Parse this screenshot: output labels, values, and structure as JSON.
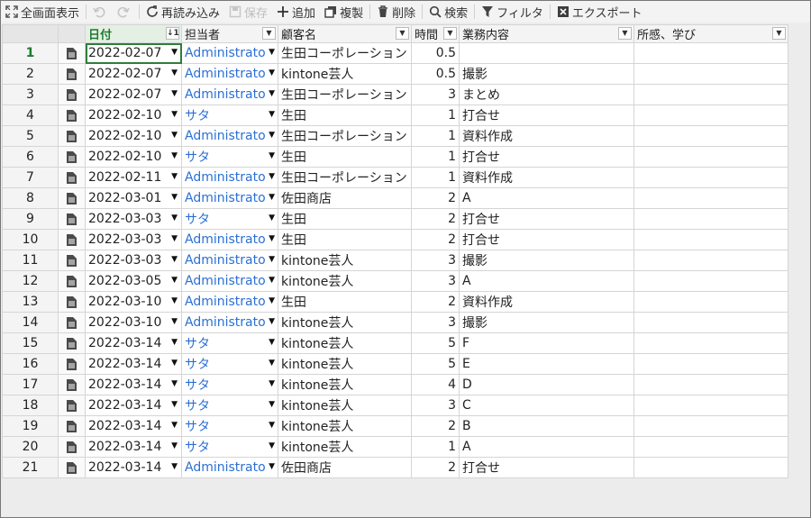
{
  "toolbar": {
    "fullscreen": "全画面表示",
    "reload": "再読み込み",
    "save": "保存",
    "add": "追加",
    "duplicate": "複製",
    "delete": "削除",
    "search": "検索",
    "filter": "フィルタ",
    "export": "エクスポート"
  },
  "columns": {
    "date": "日付",
    "owner": "担当者",
    "customer": "顧客名",
    "hours": "時間",
    "task": "業務内容",
    "notes": "所感、学び"
  },
  "rows": [
    {
      "n": "1",
      "date": "2022-02-07",
      "owner": "Administrato",
      "customer": "生田コーポレーション",
      "hours": "0.5",
      "task": "",
      "notes": ""
    },
    {
      "n": "2",
      "date": "2022-02-07",
      "owner": "Administrato",
      "customer": "kintone芸人",
      "hours": "0.5",
      "task": "撮影",
      "notes": ""
    },
    {
      "n": "3",
      "date": "2022-02-07",
      "owner": "Administrato",
      "customer": "生田コーポレーション",
      "hours": "3",
      "task": "まとめ",
      "notes": ""
    },
    {
      "n": "4",
      "date": "2022-02-10",
      "owner": "サタ",
      "customer": "生田",
      "hours": "1",
      "task": "打合せ",
      "notes": ""
    },
    {
      "n": "5",
      "date": "2022-02-10",
      "owner": "Administrato",
      "customer": "生田コーポレーション",
      "hours": "1",
      "task": "資料作成",
      "notes": ""
    },
    {
      "n": "6",
      "date": "2022-02-10",
      "owner": "サタ",
      "customer": "生田",
      "hours": "1",
      "task": "打合せ",
      "notes": ""
    },
    {
      "n": "7",
      "date": "2022-02-11",
      "owner": "Administrato",
      "customer": "生田コーポレーション",
      "hours": "1",
      "task": "資料作成",
      "notes": ""
    },
    {
      "n": "8",
      "date": "2022-03-01",
      "owner": "Administrato",
      "customer": "佐田商店",
      "hours": "2",
      "task": "A",
      "notes": ""
    },
    {
      "n": "9",
      "date": "2022-03-03",
      "owner": "サタ",
      "customer": "生田",
      "hours": "2",
      "task": "打合せ",
      "notes": ""
    },
    {
      "n": "10",
      "date": "2022-03-03",
      "owner": "Administrato",
      "customer": "生田",
      "hours": "2",
      "task": "打合せ",
      "notes": ""
    },
    {
      "n": "11",
      "date": "2022-03-03",
      "owner": "Administrato",
      "customer": "kintone芸人",
      "hours": "3",
      "task": "撮影",
      "notes": ""
    },
    {
      "n": "12",
      "date": "2022-03-05",
      "owner": "Administrato",
      "customer": "kintone芸人",
      "hours": "3",
      "task": "A",
      "notes": ""
    },
    {
      "n": "13",
      "date": "2022-03-10",
      "owner": "Administrato",
      "customer": "生田",
      "hours": "2",
      "task": "資料作成",
      "notes": ""
    },
    {
      "n": "14",
      "date": "2022-03-10",
      "owner": "Administrato",
      "customer": "kintone芸人",
      "hours": "3",
      "task": "撮影",
      "notes": ""
    },
    {
      "n": "15",
      "date": "2022-03-14",
      "owner": "サタ",
      "customer": "kintone芸人",
      "hours": "5",
      "task": "F",
      "notes": ""
    },
    {
      "n": "16",
      "date": "2022-03-14",
      "owner": "サタ",
      "customer": "kintone芸人",
      "hours": "5",
      "task": "E",
      "notes": ""
    },
    {
      "n": "17",
      "date": "2022-03-14",
      "owner": "サタ",
      "customer": "kintone芸人",
      "hours": "4",
      "task": "D",
      "notes": ""
    },
    {
      "n": "18",
      "date": "2022-03-14",
      "owner": "サタ",
      "customer": "kintone芸人",
      "hours": "3",
      "task": "C",
      "notes": ""
    },
    {
      "n": "19",
      "date": "2022-03-14",
      "owner": "サタ",
      "customer": "kintone芸人",
      "hours": "2",
      "task": "B",
      "notes": ""
    },
    {
      "n": "20",
      "date": "2022-03-14",
      "owner": "サタ",
      "customer": "kintone芸人",
      "hours": "1",
      "task": "A",
      "notes": ""
    },
    {
      "n": "21",
      "date": "2022-03-14",
      "owner": "Administrato",
      "customer": "佐田商店",
      "hours": "2",
      "task": "打合せ",
      "notes": ""
    }
  ],
  "icons": {
    "fullscreen": "fullscreen-icon",
    "undo": "undo-icon",
    "redo": "redo-icon",
    "reload": "reload-icon",
    "save": "save-icon",
    "add": "plus-icon",
    "duplicate": "copy-icon",
    "delete": "trash-icon",
    "search": "search-icon",
    "filter": "filter-icon",
    "export": "excel-icon",
    "record": "document-icon"
  },
  "colors": {
    "user_link": "#2a6fd6",
    "active_header": "#1f7a2f",
    "selection": "#2f7d3a"
  }
}
